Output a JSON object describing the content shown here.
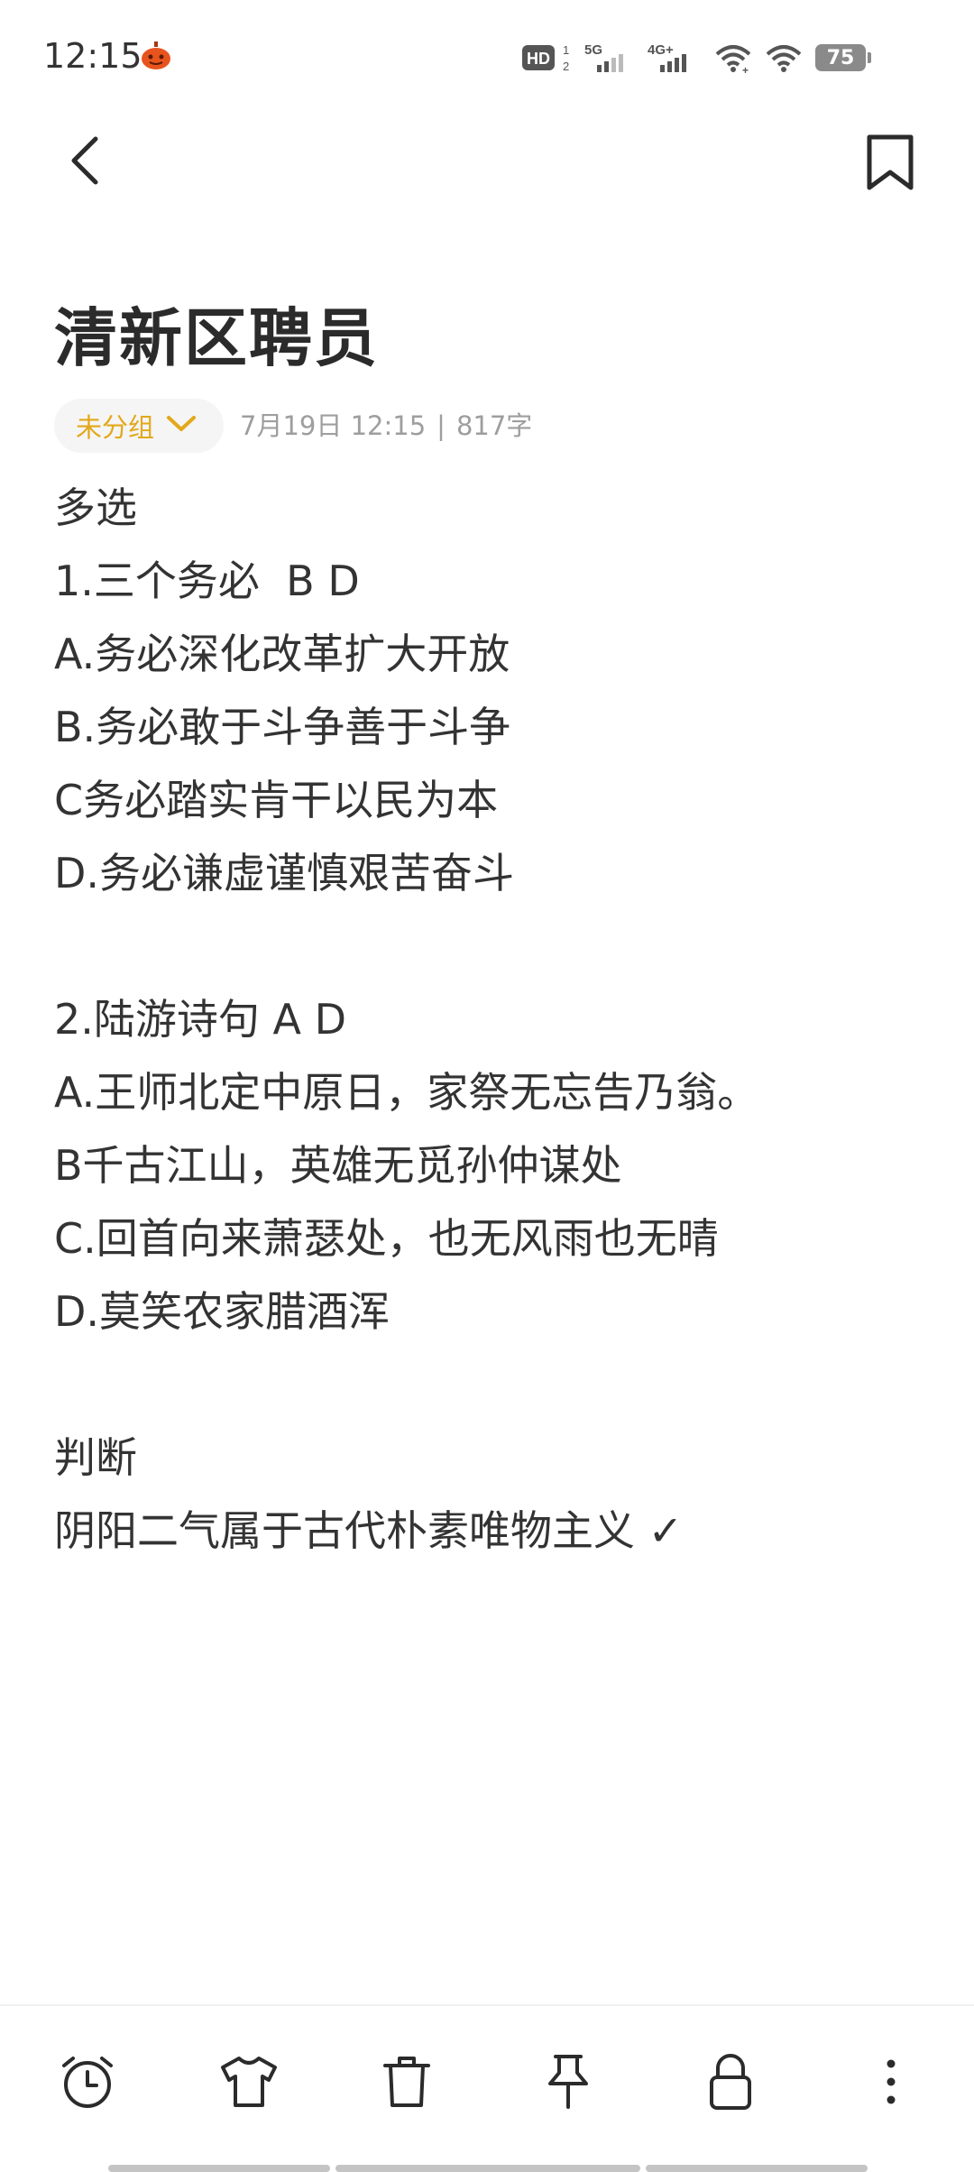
{
  "status_bar": {
    "time": "12:15",
    "hd_label": "HD",
    "net_5g": "5G",
    "net_4g": "4G+",
    "battery": "75"
  },
  "header": {
    "back_icon": "chevron-left-icon",
    "bookmark_icon": "bookmark-icon"
  },
  "note": {
    "title": "清新区聘员",
    "group_label": "未分组",
    "date": "7月19日 12:15",
    "separator": "|",
    "word_count": "817字",
    "lines": [
      "多选",
      "1.三个务必  B D",
      "A.务必深化改革扩大开放",
      "B.务必敢于斗争善于斗争",
      "C务必踏实肯干以民为本",
      "D.务必谦虚谨慎艰苦奋斗",
      "",
      "2.陆游诗句 A D",
      "A.王师北定中原日，家祭无忘告乃翁。",
      "B千古江山，英雄无觅孙仲谋处",
      "C.回首向来萧瑟处，也无风雨也无晴",
      "D.莫笑农家腊酒浑",
      "",
      "判断",
      "阴阳二气属于古代朴素唯物主义 ✓"
    ]
  },
  "toolbar": {
    "items": [
      {
        "icon": "alarm-clock-icon"
      },
      {
        "icon": "tshirt-icon"
      },
      {
        "icon": "trash-icon"
      },
      {
        "icon": "pin-icon"
      },
      {
        "icon": "lock-icon"
      },
      {
        "icon": "more-vertical-icon"
      }
    ]
  },
  "colors": {
    "accent": "#e3a81a",
    "text": "#333333",
    "meta": "#9e9e9e",
    "chip_bg": "#f5f5f5"
  }
}
